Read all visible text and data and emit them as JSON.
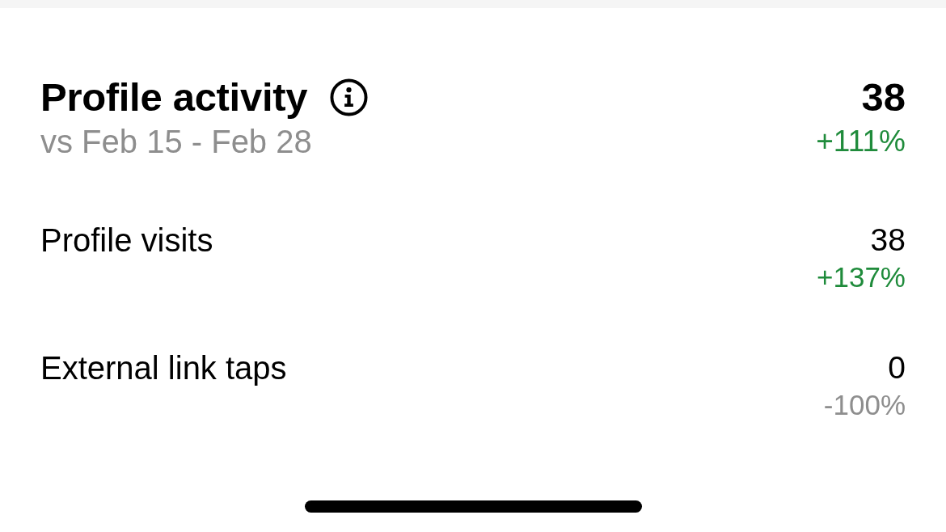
{
  "summary": {
    "title": "Profile activity",
    "subtitle": "vs Feb 15 - Feb 28",
    "value": "38",
    "change": "+111%",
    "color": "#1f8b3b"
  },
  "metrics": [
    {
      "label": "Profile visits",
      "value": "38",
      "change": "+137%",
      "color": "#1f8b3b"
    },
    {
      "label": "External link taps",
      "value": "0",
      "change": "-100%",
      "color": "#8e8e8e"
    }
  ]
}
